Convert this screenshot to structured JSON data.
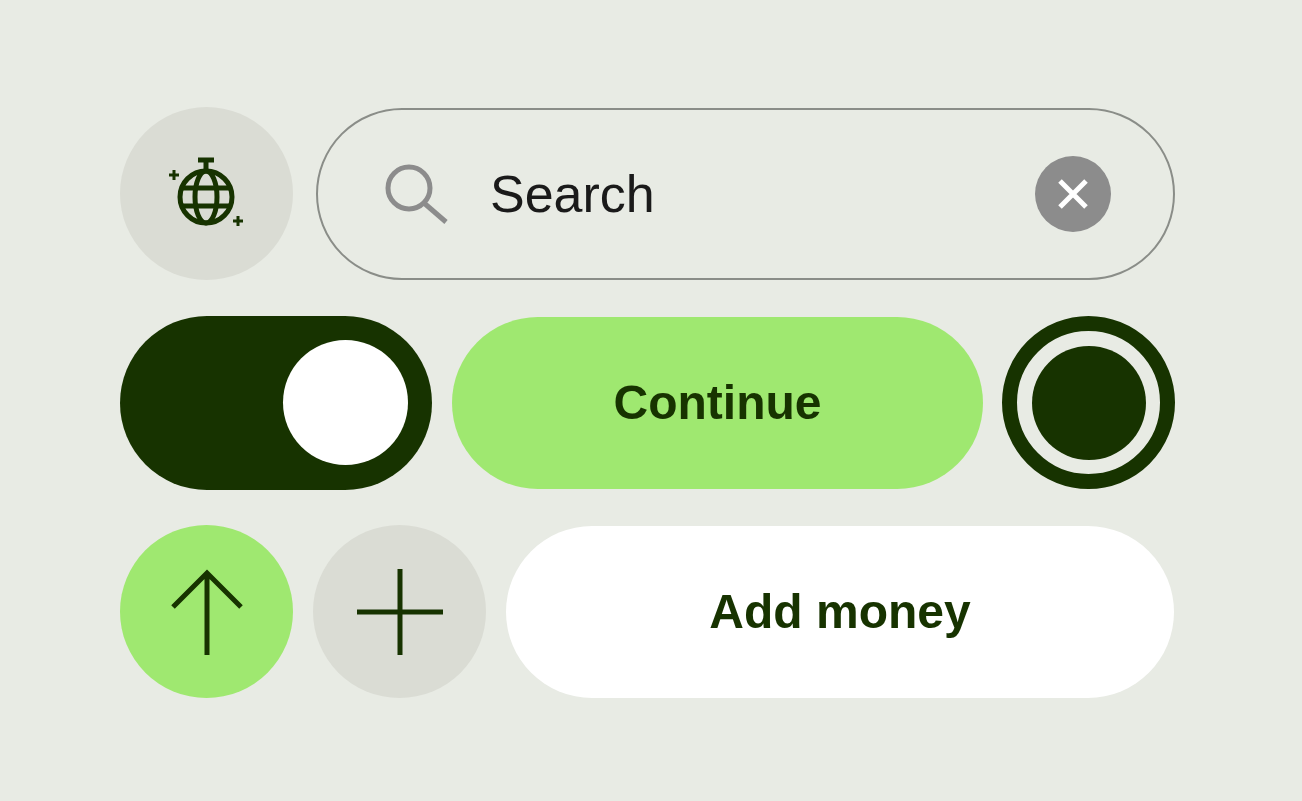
{
  "search": {
    "placeholder": "Search"
  },
  "toggle": {
    "on": true
  },
  "continue_button": {
    "label": "Continue"
  },
  "radio": {
    "selected": true
  },
  "add_money_button": {
    "label": "Add money"
  }
}
